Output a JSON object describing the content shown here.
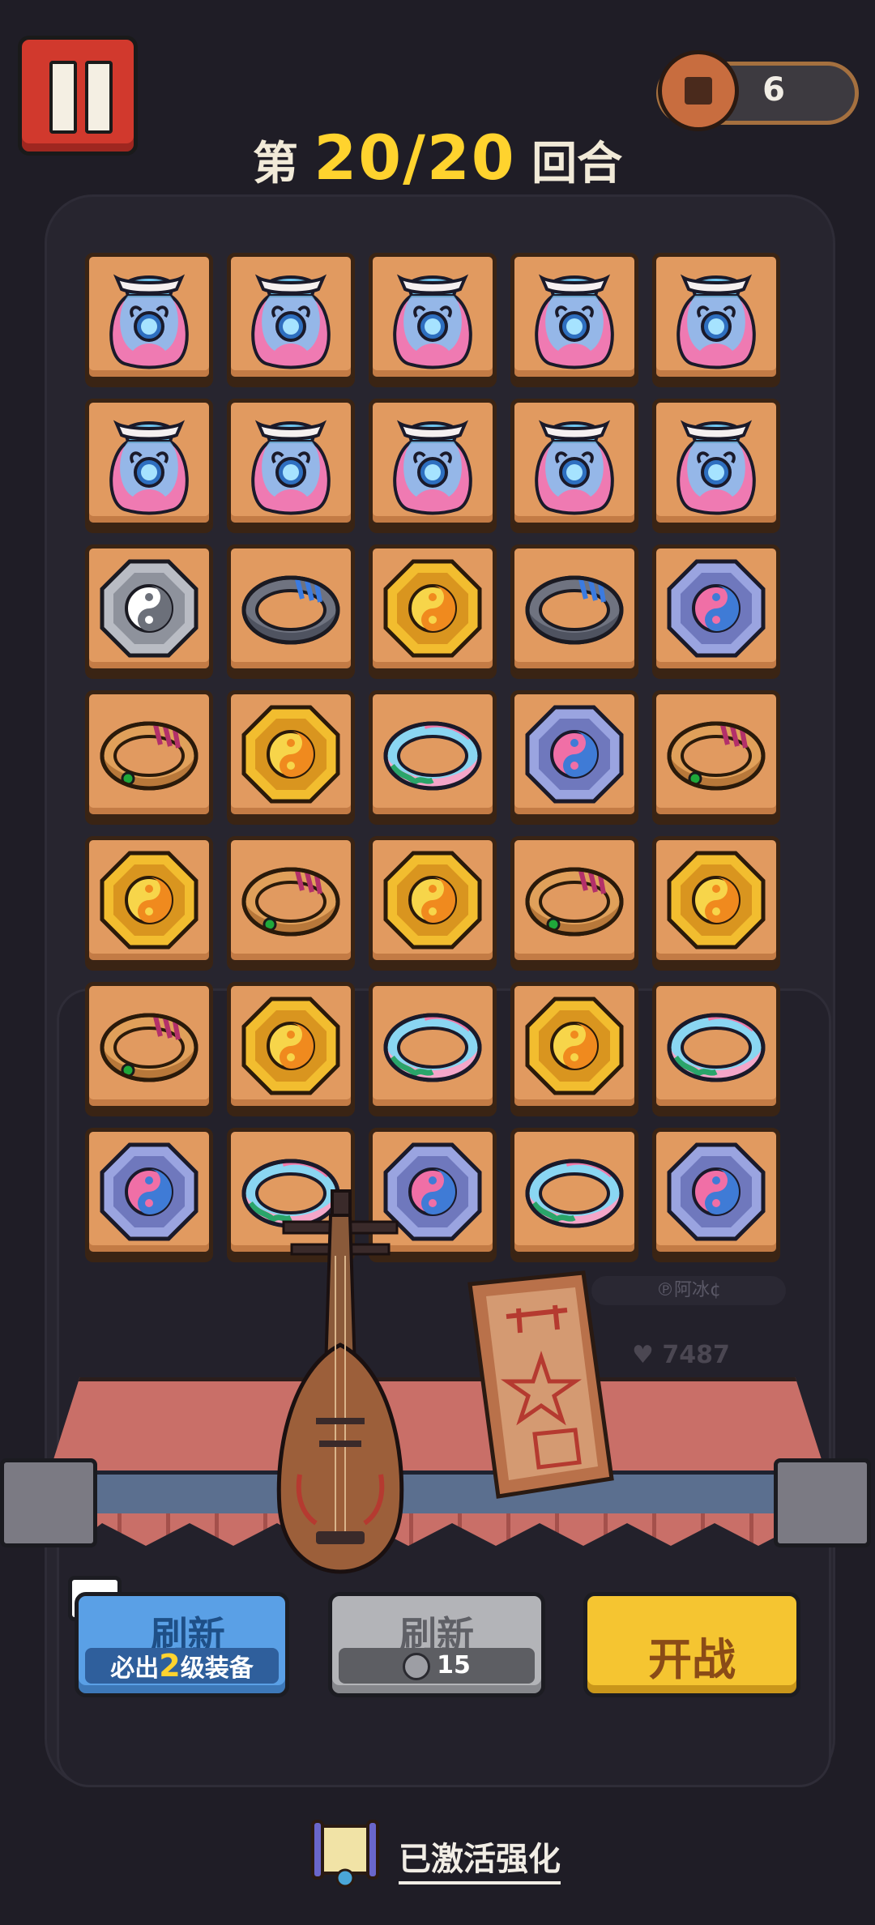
{
  "header": {
    "coins": "6",
    "round_prefix": "第",
    "round_value": "20/20",
    "round_suffix": "回合"
  },
  "grid": {
    "rows": [
      [
        "pouch",
        "pouch",
        "pouch",
        "pouch",
        "pouch"
      ],
      [
        "pouch",
        "pouch",
        "pouch",
        "pouch",
        "pouch"
      ],
      [
        "taiji-silver",
        "ring-silver",
        "taiji-gold",
        "ring-silver",
        "taiji-blue"
      ],
      [
        "ring-bronze",
        "taiji-gold",
        "ring-jade",
        "taiji-blue",
        "ring-bronze"
      ],
      [
        "taiji-gold",
        "ring-bronze",
        "taiji-gold",
        "ring-bronze",
        "taiji-gold"
      ],
      [
        "ring-bronze",
        "taiji-gold",
        "ring-jade",
        "taiji-gold",
        "ring-jade"
      ],
      [
        "taiji-blue",
        "ring-jade",
        "taiji-blue",
        "ring-jade",
        "taiji-blue"
      ]
    ]
  },
  "stage": {
    "ghost_name": "℗阿冰¢",
    "ghost_score": "7487"
  },
  "buttons": {
    "ad_refresh": {
      "label": "刷新",
      "sub_prefix": "必出",
      "sub_num": "2",
      "sub_suffix": "级装备"
    },
    "refresh": {
      "label": "刷新",
      "cost": "15"
    },
    "fight": {
      "label": "开战"
    }
  },
  "footer": {
    "enhance_label": "已激活强化"
  },
  "colors": {
    "gold": "#ffd32e",
    "tile": "#e19a60",
    "pause_red": "#d1392d",
    "ad_blue": "#5aa0e6",
    "fight_yellow": "#f5c531"
  }
}
